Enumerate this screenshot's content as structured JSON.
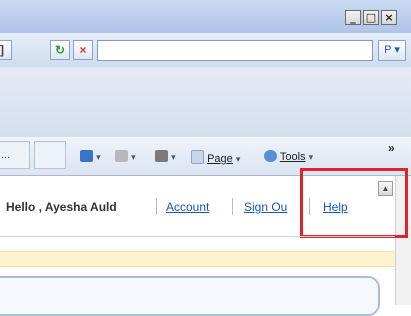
{
  "window": {
    "minimize_glyph": "_",
    "maximize_glyph": "□",
    "close_glyph": "×"
  },
  "nav": {
    "edge_glyph": "]",
    "refresh_glyph": "↻",
    "stop_glyph": "×",
    "search_value": "",
    "search_icon": "search-icon",
    "search_glyph": "P",
    "search_caret": "▾"
  },
  "command_bar": {
    "tab_stub_label": "...",
    "home_glyph": "▾",
    "feeds_glyph": "▾",
    "print_glyph": "▾",
    "page_label": "Page",
    "tools_label": "Tools",
    "chevron_glyph": "»",
    "colors": {
      "home": "#3a74c9",
      "feeds": "#b8b8b8",
      "print": "#7a7a7a",
      "page": "#c9d6ea",
      "tools": "#5a8fd6"
    }
  },
  "page": {
    "greeting": "Hello , Ayesha Auld",
    "links": {
      "account": "Account",
      "sign_out": "Sign Ou",
      "help": "Help"
    },
    "scroll_up_glyph": "▲"
  },
  "accent": {
    "highlight": "#e0242b",
    "link": "#1b56b5"
  }
}
